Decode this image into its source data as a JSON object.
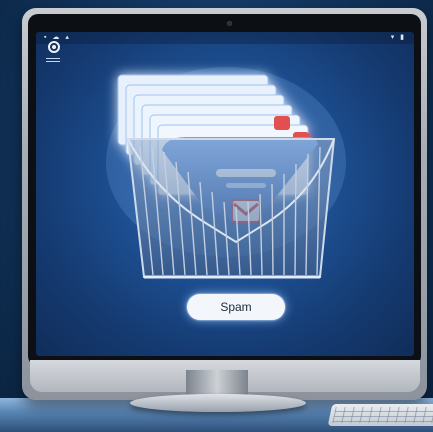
{
  "screen": {
    "button": {
      "label": "Spam"
    },
    "illustration": "spam-folder-basket",
    "status_icons": [
      "cloud-icon",
      "wifi-icon",
      "battery-icon"
    ]
  },
  "colors": {
    "screen_blue": "#1d4f92",
    "envelope_blue": "#4d86d6",
    "gmail_red": "#d93d3d",
    "button_white": "#f3f6fa"
  }
}
